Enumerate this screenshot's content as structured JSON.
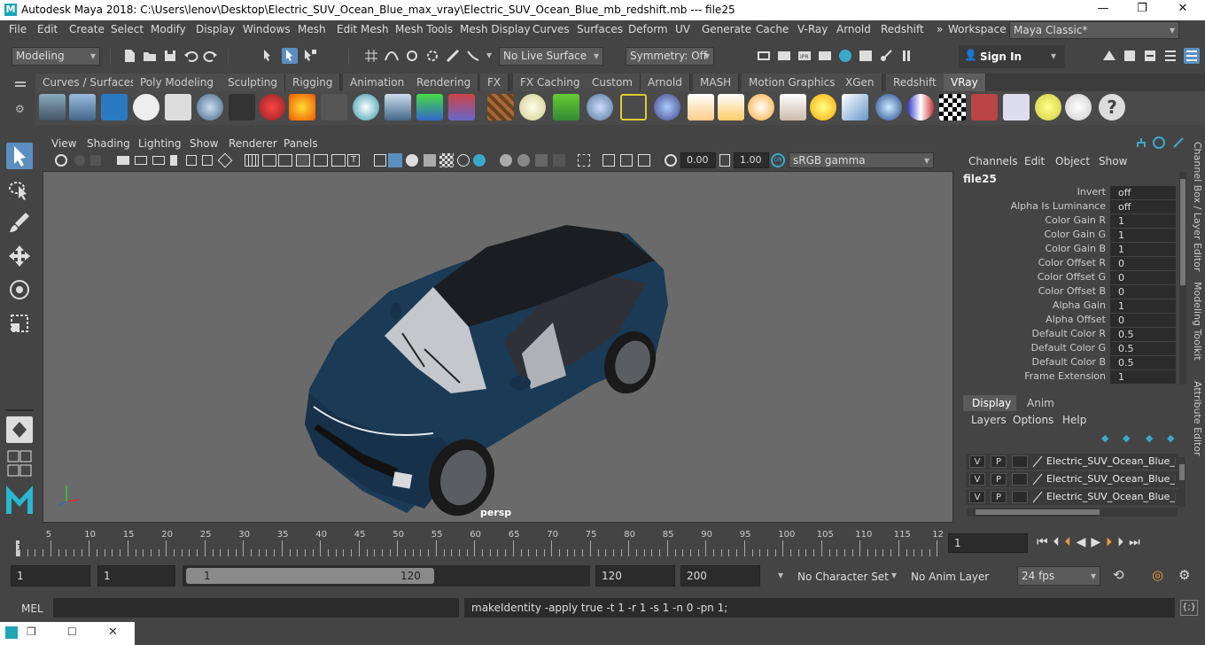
{
  "window": {
    "title": "Autodesk Maya 2018: C:\\Users\\lenov\\Desktop\\Electric_SUV_Ocean_Blue_max_vray\\Electric_SUV_Ocean_Blue_mb_redshift.mb  ---  file25",
    "minimize": "—",
    "maximize": "❐",
    "close": "✕"
  },
  "menubar": {
    "items": [
      "File",
      "Edit",
      "Create",
      "Select",
      "Modify",
      "Display",
      "Windows",
      "Mesh",
      "Edit Mesh",
      "Mesh Tools",
      "Mesh Display",
      "Curves",
      "Surfaces",
      "Deform",
      "UV",
      "Generate",
      "Cache",
      "V-Ray",
      "Arnold",
      "Redshift"
    ],
    "chevron": "»",
    "workspace_label": "Workspace :",
    "workspace_value": "Maya Classic*"
  },
  "toolbar": {
    "mode": "Modeling",
    "live_surface": "No Live Surface",
    "symmetry": "Symmetry: Off",
    "sign_in": "Sign In"
  },
  "shelf": {
    "tabs": [
      "Curves / Surfaces",
      "Poly Modeling",
      "Sculpting",
      "Rigging",
      "Animation",
      "Rendering",
      "FX",
      "FX Caching",
      "Custom",
      "Arnold",
      "MASH",
      "Motion Graphics",
      "XGen",
      "Redshift",
      "VRay"
    ],
    "active_tab": "VRay"
  },
  "viewport": {
    "menus": [
      "View",
      "Shading",
      "Lighting",
      "Show",
      "Renderer",
      "Panels"
    ],
    "exposure": "0.00",
    "gamma": "1.00",
    "color_space": "sRGB gamma",
    "camera_label": "persp",
    "car_color": "#1a3a55"
  },
  "channel_box": {
    "menus": [
      "Channels",
      "Edit",
      "Object",
      "Show"
    ],
    "node_name": "file25",
    "attributes": [
      {
        "label": "Invert",
        "value": "off"
      },
      {
        "label": "Alpha Is Luminance",
        "value": "off"
      },
      {
        "label": "Color Gain R",
        "value": "1"
      },
      {
        "label": "Color Gain G",
        "value": "1"
      },
      {
        "label": "Color Gain B",
        "value": "1"
      },
      {
        "label": "Color Offset R",
        "value": "0"
      },
      {
        "label": "Color Offset G",
        "value": "0"
      },
      {
        "label": "Color Offset B",
        "value": "0"
      },
      {
        "label": "Alpha Gain",
        "value": "1"
      },
      {
        "label": "Alpha Offset",
        "value": "0"
      },
      {
        "label": "Default Color R",
        "value": "0.5"
      },
      {
        "label": "Default Color G",
        "value": "0.5"
      },
      {
        "label": "Default Color B",
        "value": "0.5"
      },
      {
        "label": "Frame Extension",
        "value": "1"
      }
    ],
    "side_tabs": [
      "Channel Box / Layer Editor",
      "Modeling Toolkit",
      "Attribute Editor"
    ]
  },
  "layer_editor": {
    "tabs": [
      "Display",
      "Anim"
    ],
    "active_tab": "Display",
    "menus": [
      "Layers",
      "Options",
      "Help"
    ],
    "layers": [
      {
        "v": "V",
        "p": "P",
        "name": "Electric_SUV_Ocean_Blue_lay"
      },
      {
        "v": "V",
        "p": "P",
        "name": "Electric_SUV_Ocean_Blue_lay"
      },
      {
        "v": "V",
        "p": "P",
        "name": "Electric_SUV_Ocean_Blue_lay"
      }
    ]
  },
  "timeline": {
    "ticks": [
      "5",
      "10",
      "15",
      "20",
      "25",
      "30",
      "35",
      "40",
      "45",
      "50",
      "55",
      "60",
      "65",
      "70",
      "75",
      "80",
      "85",
      "90",
      "95",
      "100",
      "105",
      "110",
      "115",
      "12"
    ],
    "start_marker": "1",
    "current_frame": "1"
  },
  "range": {
    "start": "1",
    "playback_start": "1",
    "slider_start": "1",
    "slider_end": "120",
    "playback_end": "120",
    "end": "200",
    "character_set": "No Character Set",
    "anim_layer": "No Anim Layer",
    "fps": "24 fps"
  },
  "command_line": {
    "label": "MEL",
    "feedback": "makeIdentity -apply true -t 1 -r 1 -s 1 -n 0 -pn 1;"
  }
}
